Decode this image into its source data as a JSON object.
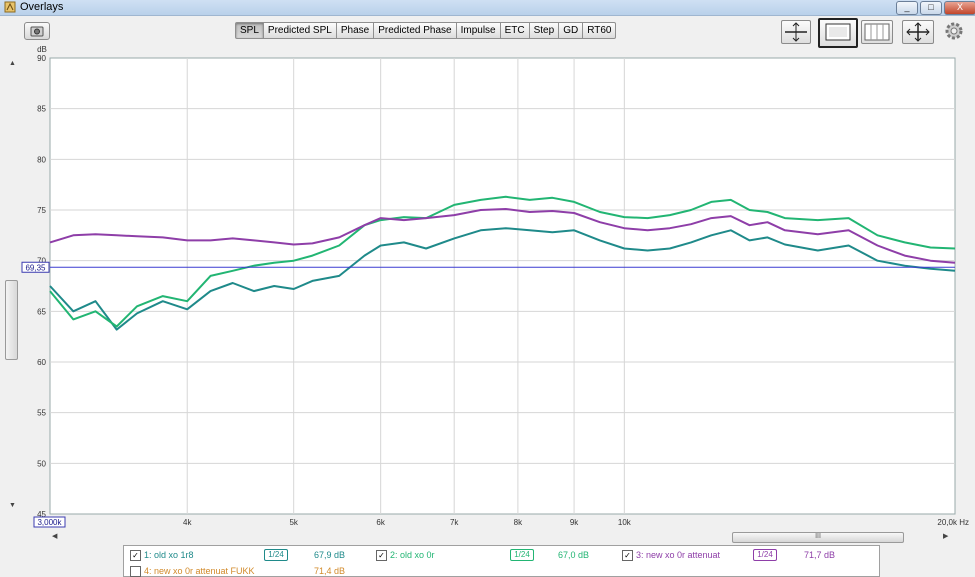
{
  "window": {
    "title": "Overlays",
    "controls": [
      "_",
      "□",
      "X"
    ]
  },
  "tabs": [
    {
      "label": "SPL",
      "active": true
    },
    {
      "label": "Predicted SPL",
      "active": false
    },
    {
      "label": "Phase",
      "active": false
    },
    {
      "label": "Predicted Phase",
      "active": false
    },
    {
      "label": "Impulse",
      "active": false
    },
    {
      "label": "ETC",
      "active": false
    },
    {
      "label": "Step",
      "active": false
    },
    {
      "label": "GD",
      "active": false
    },
    {
      "label": "RT60",
      "active": false
    }
  ],
  "toolbar_icons": [
    "camera-icon",
    "vertical-zoom-icon",
    "display-icon",
    "grid-icon",
    "pan-icon",
    "gear-icon"
  ],
  "y_unit": "dB",
  "cursor_value": "69,35",
  "x_start_label": "3,000k",
  "x_end_label": "20,0k Hz",
  "h_thumb_label": "III",
  "chart_data": {
    "type": "line",
    "y_ticks": [
      "90",
      "85",
      "80",
      "75",
      "70",
      "65",
      "60",
      "55",
      "50",
      "45"
    ],
    "ylim": [
      45,
      90
    ],
    "xlim": [
      3000,
      20000
    ],
    "x_scale": "log",
    "x_ticks": [
      {
        "label": "4k",
        "value": 4000
      },
      {
        "label": "5k",
        "value": 5000
      },
      {
        "label": "6k",
        "value": 6000
      },
      {
        "label": "7k",
        "value": 7000
      },
      {
        "label": "8k",
        "value": 8000
      },
      {
        "label": "9k",
        "value": 9000
      },
      {
        "label": "10k",
        "value": 10000
      }
    ],
    "cursor_y": 69.35,
    "grid": true,
    "series": [
      {
        "name": "1: old xo 1r8",
        "color": "#1f8a8a",
        "x": [
          3000,
          3150,
          3300,
          3450,
          3600,
          3800,
          4000,
          4200,
          4400,
          4600,
          4800,
          5000,
          5200,
          5500,
          5800,
          6000,
          6300,
          6600,
          7000,
          7400,
          7800,
          8200,
          8600,
          9000,
          9500,
          10000,
          10500,
          11000,
          11500,
          12000,
          12500,
          13000,
          13500,
          14000,
          15000,
          16000,
          17000,
          18000,
          19000,
          20000
        ],
        "y": [
          67.5,
          65.0,
          66.0,
          63.2,
          64.8,
          66.0,
          65.2,
          67.0,
          67.8,
          67.0,
          67.5,
          67.2,
          68.0,
          68.5,
          70.5,
          71.5,
          71.8,
          71.2,
          72.2,
          73.0,
          73.2,
          73.0,
          72.8,
          73.0,
          72.0,
          71.2,
          71.0,
          71.2,
          71.8,
          72.5,
          73.0,
          72.0,
          72.3,
          71.6,
          71.0,
          71.5,
          70.0,
          69.5,
          69.2,
          69.0
        ]
      },
      {
        "name": "2: old xo 0r",
        "color": "#22b573",
        "x": [
          3000,
          3150,
          3300,
          3450,
          3600,
          3800,
          4000,
          4200,
          4400,
          4600,
          4800,
          5000,
          5200,
          5500,
          5800,
          6000,
          6300,
          6600,
          7000,
          7400,
          7800,
          8200,
          8600,
          9000,
          9500,
          10000,
          10500,
          11000,
          11500,
          12000,
          12500,
          13000,
          13500,
          14000,
          15000,
          16000,
          17000,
          18000,
          19000,
          20000
        ],
        "y": [
          67.0,
          64.2,
          65.0,
          63.5,
          65.5,
          66.5,
          66.0,
          68.5,
          69.0,
          69.5,
          69.8,
          70.0,
          70.5,
          71.5,
          73.5,
          74.0,
          74.3,
          74.2,
          75.5,
          76.0,
          76.3,
          76.0,
          76.2,
          75.8,
          74.8,
          74.3,
          74.2,
          74.5,
          75.0,
          75.8,
          76.0,
          75.0,
          74.8,
          74.2,
          74.0,
          74.2,
          72.5,
          71.8,
          71.3,
          71.2
        ]
      },
      {
        "name": "3: new xo 0r attenuat",
        "color": "#8e3ea8",
        "x": [
          3000,
          3150,
          3300,
          3450,
          3600,
          3800,
          4000,
          4200,
          4400,
          4600,
          4800,
          5000,
          5200,
          5500,
          5800,
          6000,
          6300,
          6600,
          7000,
          7400,
          7800,
          8200,
          8600,
          9000,
          9500,
          10000,
          10500,
          11000,
          11500,
          12000,
          12500,
          13000,
          13500,
          14000,
          15000,
          16000,
          17000,
          18000,
          19000,
          20000
        ],
        "y": [
          71.8,
          72.5,
          72.6,
          72.5,
          72.4,
          72.3,
          72.0,
          72.0,
          72.2,
          72.0,
          71.8,
          71.6,
          71.7,
          72.3,
          73.5,
          74.2,
          74.0,
          74.2,
          74.5,
          75.0,
          75.1,
          74.8,
          74.9,
          74.7,
          73.8,
          73.2,
          73.0,
          73.2,
          73.6,
          74.2,
          74.4,
          73.5,
          73.8,
          73.0,
          72.6,
          73.0,
          71.5,
          70.5,
          70.0,
          69.8
        ]
      }
    ]
  },
  "legend": [
    {
      "label": "1: old xo 1r8",
      "smoothing": "1/24",
      "value": "67,9 dB",
      "color": "#1f8a8a",
      "checked": true
    },
    {
      "label": "2: old xo 0r",
      "smoothing": "1/24",
      "value": "67,0 dB",
      "color": "#22b573",
      "checked": true
    },
    {
      "label": "3: new xo 0r attenuat",
      "smoothing": "1/24",
      "value": "71,7 dB",
      "color": "#8e3ea8",
      "checked": true
    },
    {
      "label": "4: new xo 0r attenuat FUKK",
      "value": "71,4 dB",
      "color": "#d28a2a",
      "checked": false
    }
  ]
}
